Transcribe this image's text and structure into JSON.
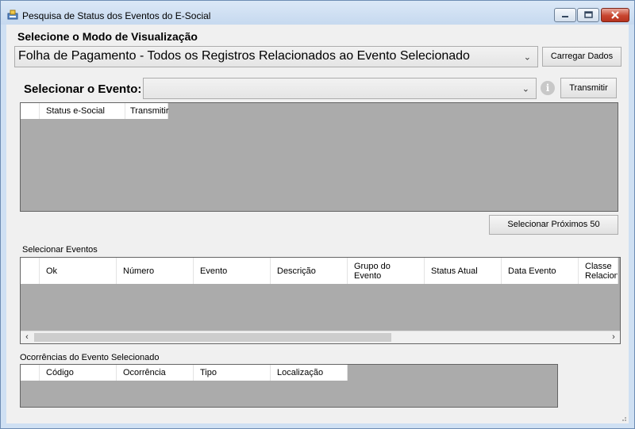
{
  "window": {
    "title": "Pesquisa de Status dos Eventos do E-Social"
  },
  "mode": {
    "label": "Selecione o Modo de Visualização",
    "selected": "Folha de Pagamento - Todos os Registros Relacionados ao Evento Selecionado",
    "load_button": "Carregar Dados"
  },
  "event": {
    "label": "Selecionar o Evento:",
    "selected": "",
    "transmit_button": "Transmitir"
  },
  "status_grid": {
    "columns": [
      "Status e-Social",
      "Transmitir"
    ]
  },
  "next_button": "Selecionar Próximos 50",
  "events_grid": {
    "label": "Selecionar Eventos",
    "columns": [
      "Ok",
      "Número",
      "Evento",
      "Descrição",
      "Grupo do\nEvento",
      "Status Atual",
      "Data Evento",
      "Classe\nRelacionada"
    ]
  },
  "occurrences_grid": {
    "label": "Ocorrências do Evento Selecionado",
    "columns": [
      "Código",
      "Ocorrência",
      "Tipo",
      "Localização"
    ]
  },
  "icons": {
    "app": "app-icon",
    "minimize": "minimize-icon",
    "maximize": "maximize-icon",
    "close": "close-icon",
    "dropdown": "chevron-down-icon",
    "info": "info-icon",
    "scroll_left": "chevron-left-icon",
    "scroll_right": "chevron-right-icon"
  }
}
